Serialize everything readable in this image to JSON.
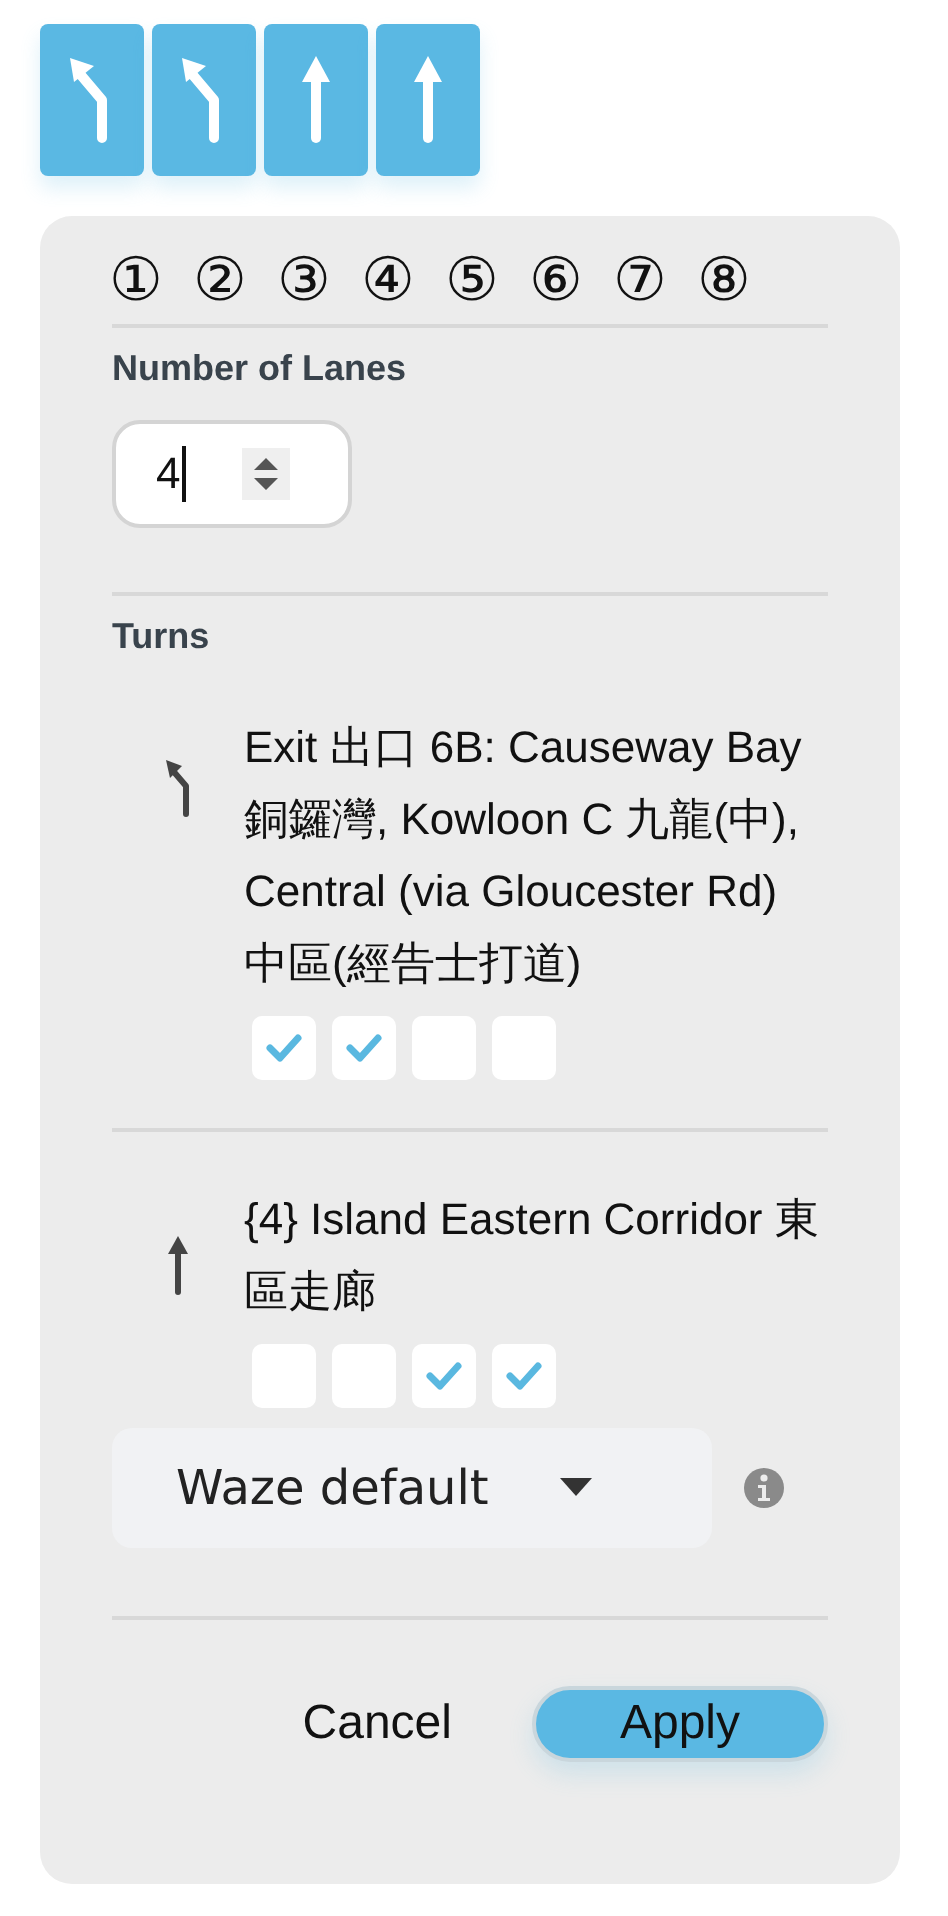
{
  "lanes": [
    {
      "kind": "left"
    },
    {
      "kind": "left"
    },
    {
      "kind": "straight"
    },
    {
      "kind": "straight"
    }
  ],
  "lane_numbers": [
    "①",
    "②",
    "③",
    "④",
    "⑤",
    "⑥",
    "⑦",
    "⑧"
  ],
  "number_of_lanes": {
    "label": "Number of Lanes",
    "value": "4"
  },
  "turns": {
    "label": "Turns",
    "items": [
      {
        "kind": "left",
        "text": "Exit 出口 6B: Causeway Bay 銅鑼灣, Kowloon C 九龍(中), Central (via Gloucester Rd) 中區(經告士打道)",
        "lanes": [
          {
            "checked": true
          },
          {
            "checked": true
          },
          {
            "checked": false
          },
          {
            "checked": false
          }
        ]
      },
      {
        "kind": "straight",
        "text": "{4} Island Eastern Corridor 東區走廊",
        "lanes": [
          {
            "checked": false
          },
          {
            "checked": false
          },
          {
            "checked": true
          },
          {
            "checked": true
          }
        ]
      }
    ]
  },
  "angle_dropdown": {
    "value": "Waze default"
  },
  "buttons": [
    {
      "kind": "cancel",
      "label": "Cancel"
    },
    {
      "kind": "apply",
      "label": "Apply"
    }
  ]
}
